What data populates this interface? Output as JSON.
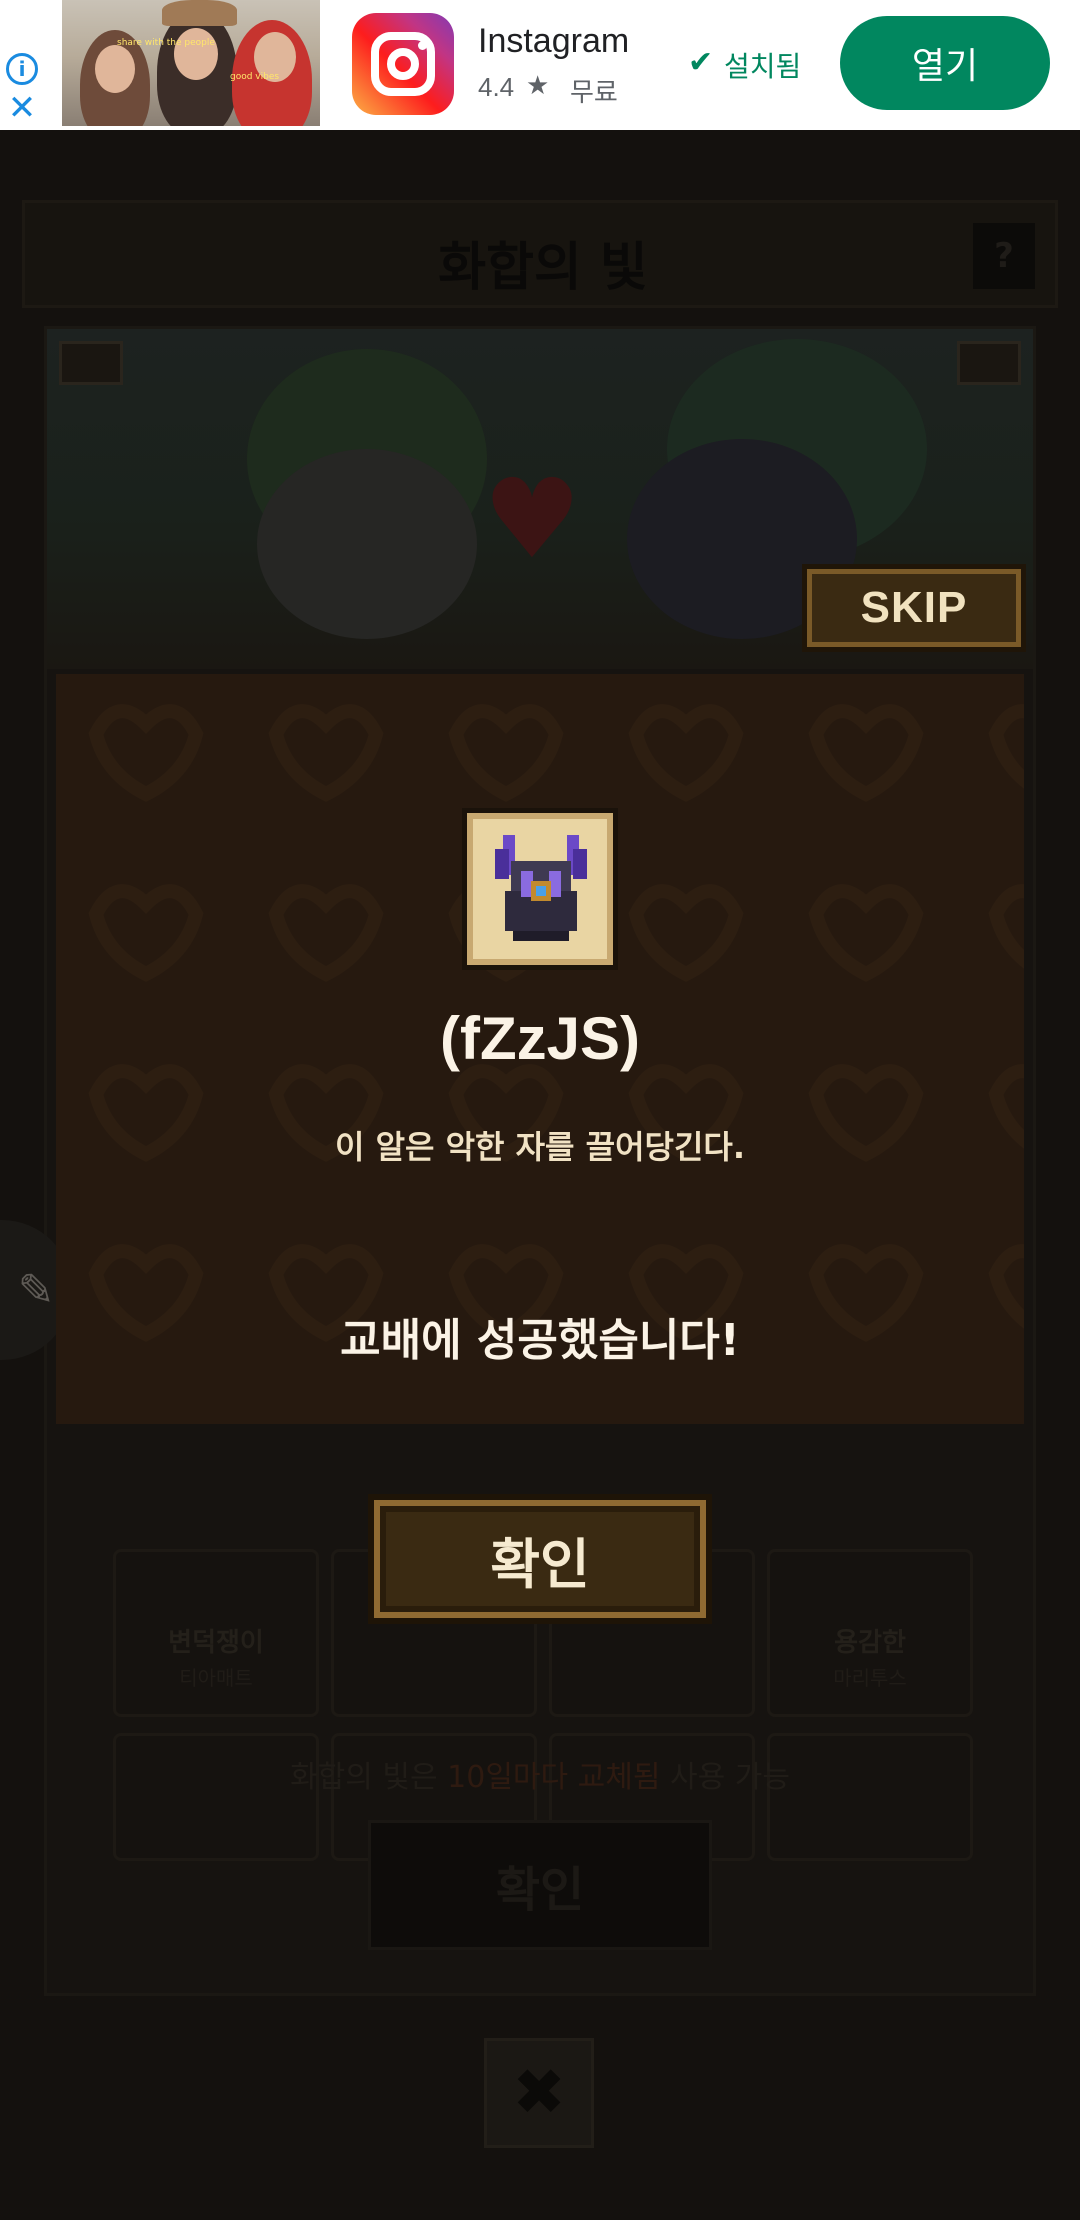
{
  "ad": {
    "app_name": "Instagram",
    "rating": "4.4",
    "rating_star": "★",
    "price": "무료",
    "installed_label": "설치됨",
    "open_button_label": "열기",
    "photo_tags": [
      "share with the people",
      "good vibes"
    ],
    "brand_color": "#01875f",
    "icons": [
      "ad-info-icon",
      "ad-close-icon",
      "instagram-logo-icon",
      "star-icon",
      "installed-check-icon"
    ]
  },
  "game": {
    "title": "화합의 빛",
    "help_label": "?",
    "skip_label": "SKIP",
    "cards": [
      {
        "name": "변덕쟁이",
        "sub": "티아매트"
      },
      {
        "name": "",
        "sub": ""
      },
      {
        "name": "",
        "sub": ""
      },
      {
        "name": "용감한",
        "sub": "마리투스"
      }
    ],
    "footer": {
      "prefix": "화합의 빛은 ",
      "highlight": "10일마다 교체됨",
      "suffix": " 사용 가능"
    },
    "bg_confirm_label": "확인",
    "close_label": "✖",
    "edit_icon": "✎"
  },
  "modal": {
    "item_name": "(fZzJS)",
    "item_description": "이 알은 악한 자를 끌어당긴다.",
    "result_message": "교배에 성공했습니다!",
    "confirm_label": "확인"
  },
  "colors": {
    "modal_bg": "#26190f",
    "button_gold": "#8f6a32",
    "text_cream": "#f6ead0"
  }
}
